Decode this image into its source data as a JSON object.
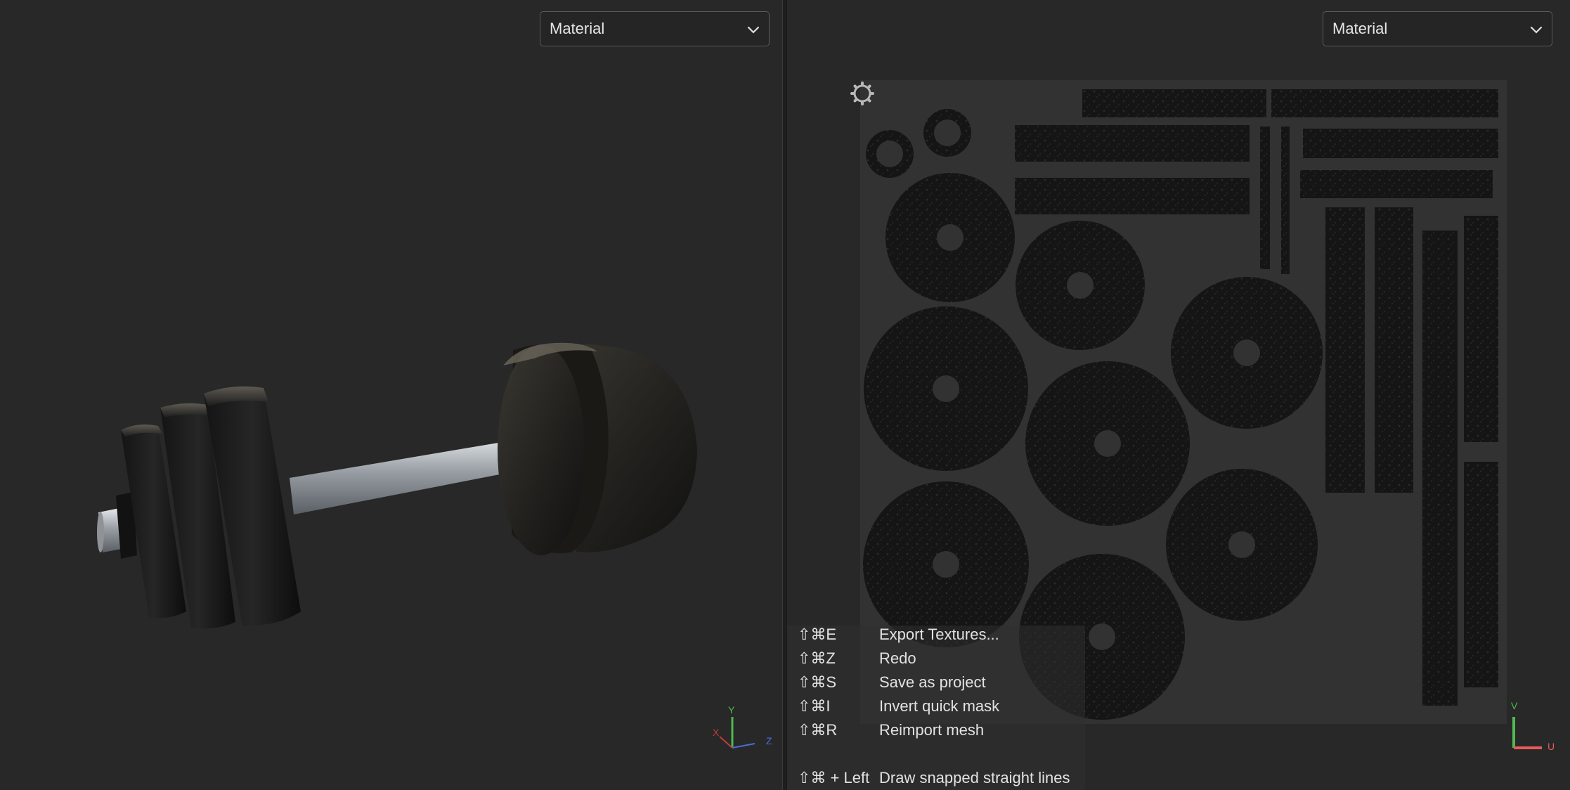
{
  "left_viewport": {
    "dropdown": {
      "selected": "Material",
      "icon": "chevron-down-icon"
    },
    "axis_gizmo": {
      "x": "X",
      "y": "Y",
      "z": "Z"
    }
  },
  "right_viewport": {
    "dropdown": {
      "selected": "Material",
      "icon": "chevron-down-icon"
    },
    "uv_axis": {
      "u": "U",
      "v": "V"
    },
    "settings_icon": "gear-icon"
  },
  "shortcuts": [
    {
      "key": "⇧⌘E",
      "action": "Export Textures..."
    },
    {
      "key": "⇧⌘Z",
      "action": "Redo"
    },
    {
      "key": "⇧⌘S",
      "action": "Save as project"
    },
    {
      "key": "⇧⌘I",
      "action": "Invert quick mask"
    },
    {
      "key": "⇧⌘R",
      "action": "Reimport mesh"
    },
    {
      "key": "⇧⌘ + Left",
      "action": "Draw snapped straight lines"
    }
  ],
  "colors": {
    "viewport_bg": "#282828",
    "uv_canvas": "#323232",
    "island": "#141414",
    "axis_x": "#c23b3b",
    "axis_y": "#4fb84f",
    "axis_z": "#4a6ed6"
  }
}
